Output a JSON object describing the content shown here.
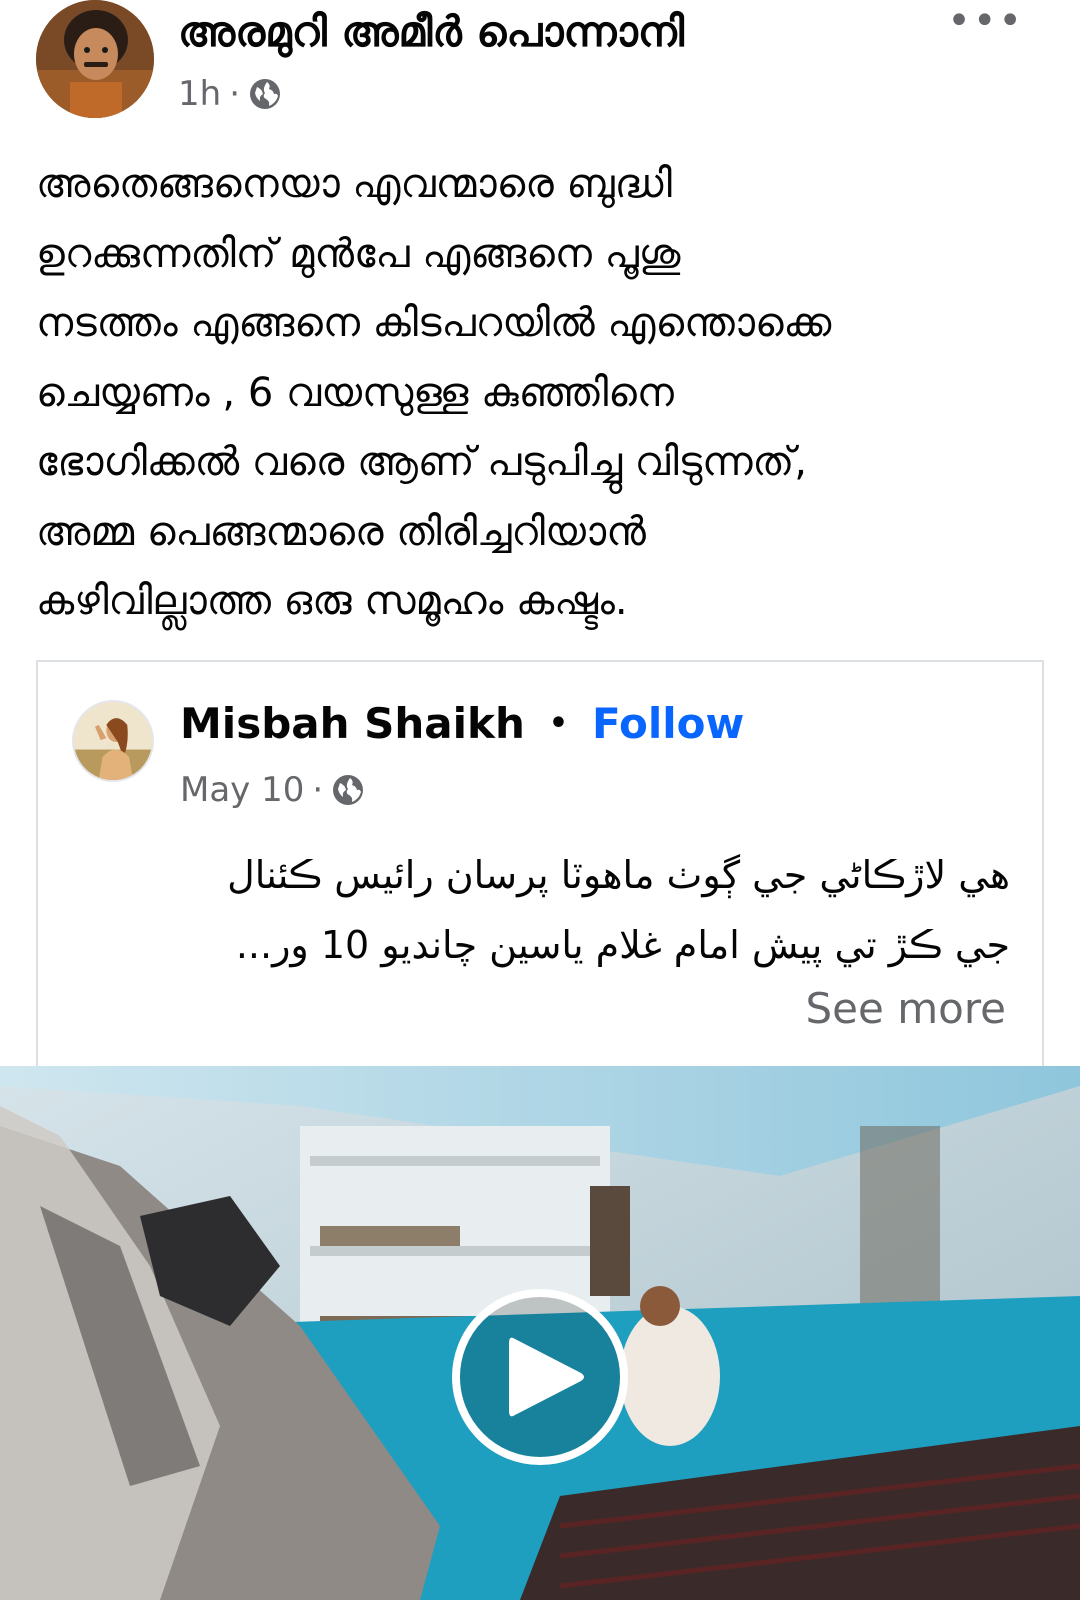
{
  "post": {
    "author_name": "അരമുറി അമീർ പൊന്നാനി",
    "time": "1h",
    "visibility_icon": "globe-icon",
    "more_icon": "more-options-icon",
    "text_lines": [
      "അതെങ്ങനെയാ എവന്മാരെ ബുദ്ധി",
      "ഉറക്കുന്നതിന് മുൻപേ എങ്ങനെ പൂശു",
      "നടത്തം എങ്ങനെ കിടപറയിൽ എന്തൊക്കെ",
      "ചെയ്യണം , 6 വയസുള്ള കുഞ്ഞിനെ",
      "ഭോഗിക്കൽ വരെ ആണ് പടുപിച്ചു വിടുന്നത്,",
      "അമ്മ പെങ്ങന്മാരെ തിരിച്ചറിയാൻ",
      "കഴിവില്ലാത്ത ഒരു സമൂഹം കഷ്ടം."
    ]
  },
  "shared_post": {
    "author_name": "Misbah Shaikh",
    "separator": "•",
    "follow_label": "Follow",
    "date": "May 10",
    "visibility_icon": "globe-icon",
    "text_lines": [
      "هي لاڙڪاڻي جي ڳوٺ ماهوٽا پرسان رائيس ڪئنال",
      "جي ڪڙ تي  پيش امام غلام ياسين چانديو 10 ور..."
    ],
    "see_more_label": "See more"
  },
  "video": {
    "play_icon": "play-icon"
  },
  "colors": {
    "link_blue": "#0866ff",
    "meta_gray": "#65676b",
    "text": "#050505"
  }
}
